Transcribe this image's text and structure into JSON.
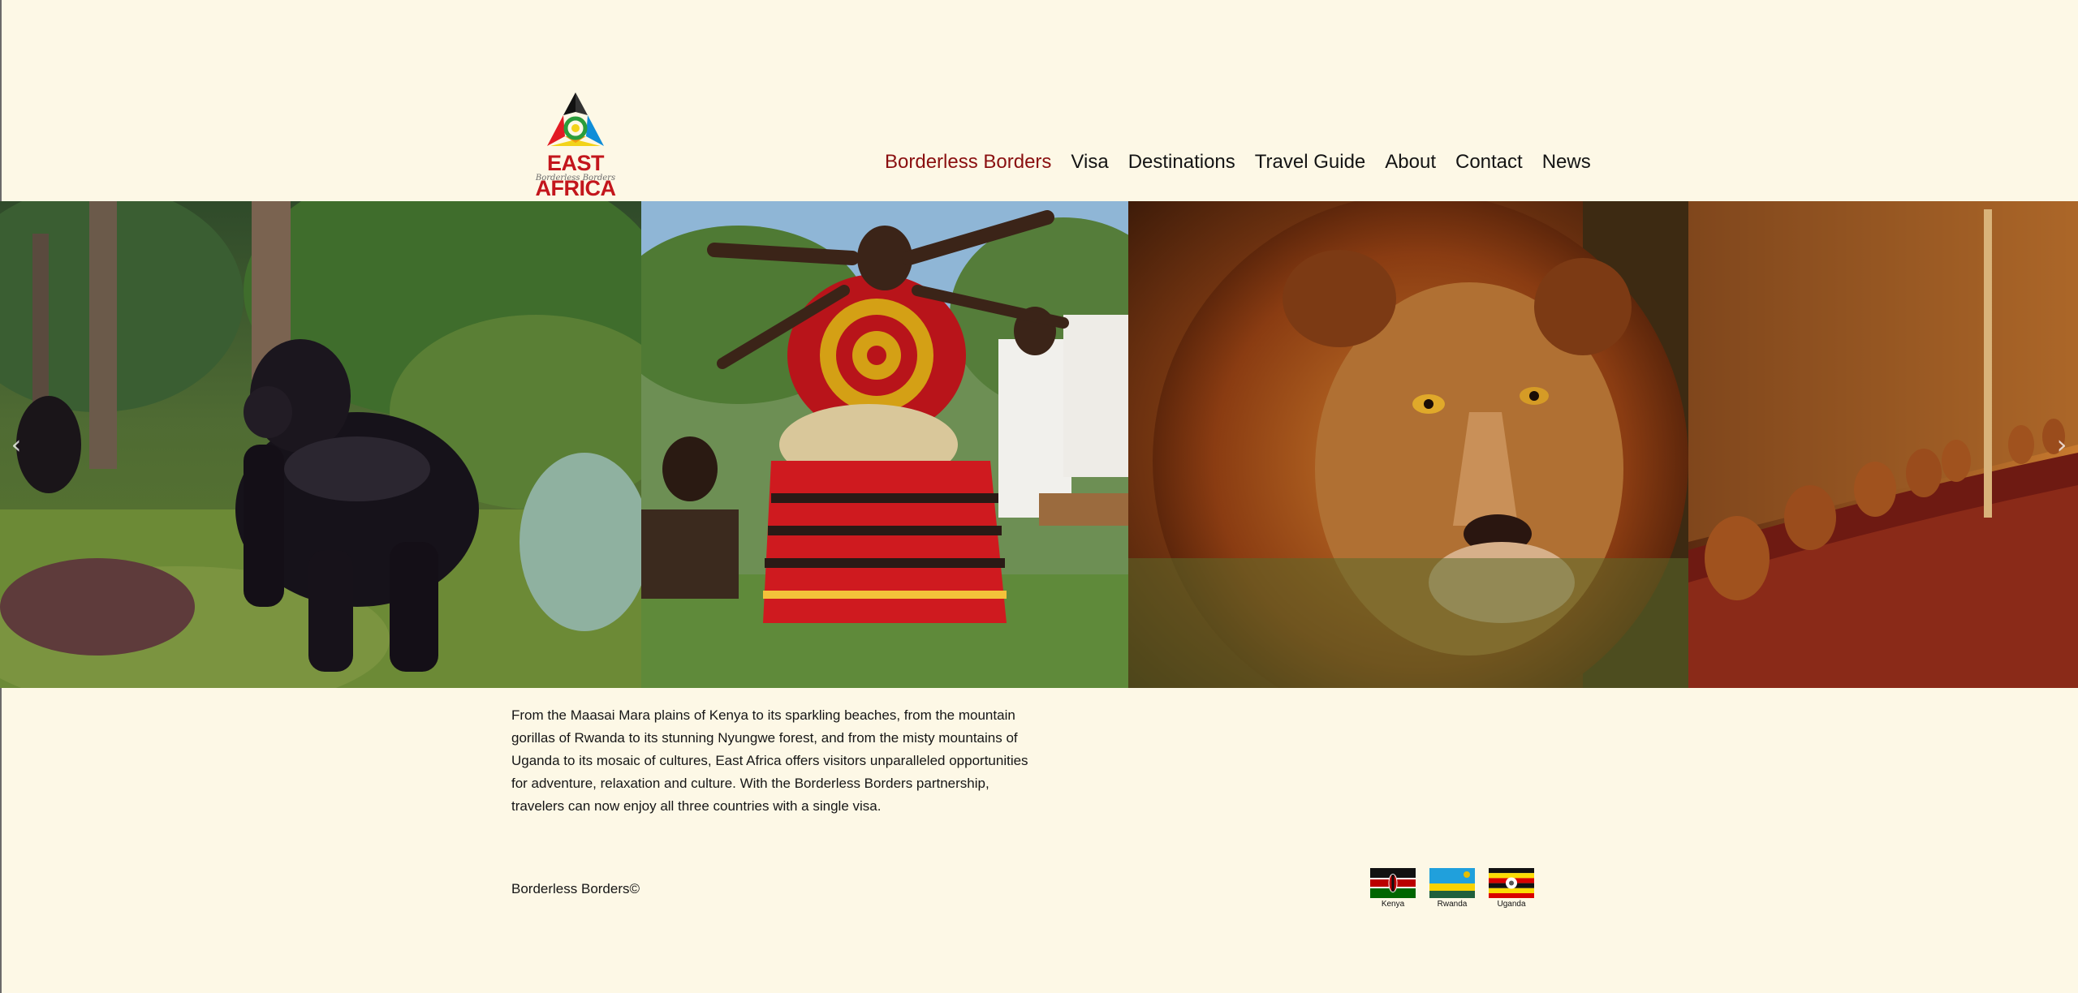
{
  "logo": {
    "title": "EAST AFRICA",
    "tagline": "Borderless Borders"
  },
  "nav": {
    "items": [
      {
        "label": "Borderless Borders",
        "active": true
      },
      {
        "label": "Visa"
      },
      {
        "label": "Destinations"
      },
      {
        "label": "Travel Guide"
      },
      {
        "label": "About"
      },
      {
        "label": "Contact"
      },
      {
        "label": "News"
      }
    ]
  },
  "hero": {
    "photos": [
      "gorilla",
      "dancers",
      "lion",
      "woven-hut-interior"
    ],
    "prev_icon": "chevron-left-icon",
    "next_icon": "chevron-right-icon"
  },
  "intro": {
    "text": "From the Maasai Mara plains of Kenya to its sparkling beaches, from the mountain gorillas of Rwanda to its stunning Nyungwe forest, and from the misty mountains of Uganda to its mosaic of cultures, East Africa offers visitors unparalleled opportunities for adventure, relaxation and culture. With the Borderless Borders partnership, travelers can now enjoy all three countries with a single visa."
  },
  "footer": {
    "copyright": "Borderless Borders©"
  },
  "flags": [
    {
      "label": "Kenya"
    },
    {
      "label": "Rwanda"
    },
    {
      "label": "Uganda"
    }
  ],
  "colors": {
    "background": "#fdf8e6",
    "nav_active": "#8a0f10",
    "logo_red": "#c3161c"
  }
}
